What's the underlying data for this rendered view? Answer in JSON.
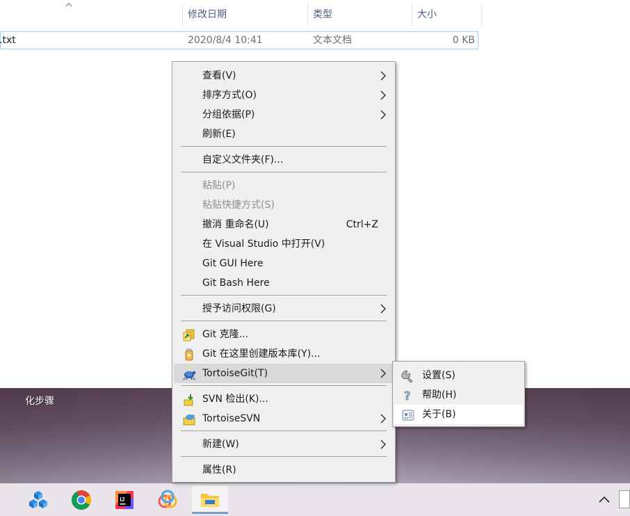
{
  "explorer": {
    "columns": {
      "date": "修改日期",
      "type": "类型",
      "size": "大小"
    },
    "file": {
      "name": ".txt",
      "date": "2020/8/4 10:41",
      "type": "文本文档",
      "size": "0 KB"
    }
  },
  "desktop": {
    "label": "化步骤"
  },
  "context_menu": {
    "items": [
      {
        "label": "查看(V)"
      },
      {
        "label": "排序方式(O)"
      },
      {
        "label": "分组依据(P)"
      },
      {
        "label": "刷新(E)"
      },
      {
        "label": "自定义文件夹(F)..."
      },
      {
        "label": "粘贴(P)"
      },
      {
        "label": "粘贴快捷方式(S)"
      },
      {
        "label": "撤消 重命名(U)",
        "shortcut": "Ctrl+Z"
      },
      {
        "label": "在 Visual Studio 中打开(V)"
      },
      {
        "label": "Git GUI Here"
      },
      {
        "label": "Git Bash Here"
      },
      {
        "label": "授予访问权限(G)"
      },
      {
        "label": "Git 克隆..."
      },
      {
        "label": "Git 在这里创建版本库(Y)..."
      },
      {
        "label": "TortoiseGit(T)"
      },
      {
        "label": "SVN 检出(K)..."
      },
      {
        "label": "TortoiseSVN"
      },
      {
        "label": "新建(W)"
      },
      {
        "label": "属性(R)"
      }
    ]
  },
  "submenu": {
    "items": [
      {
        "label": "设置(S)"
      },
      {
        "label": "帮助(H)"
      },
      {
        "label": "关于(B)"
      }
    ]
  },
  "colors": {
    "accent": "#0078d7",
    "menu_bg": "#f0f0f0",
    "highlight": "#d9d9d9"
  },
  "taskbar": {
    "icons": [
      "app-cube-icon",
      "chrome-icon",
      "intellij-icon",
      "colorful-ring-app-icon",
      "file-explorer-icon"
    ]
  }
}
